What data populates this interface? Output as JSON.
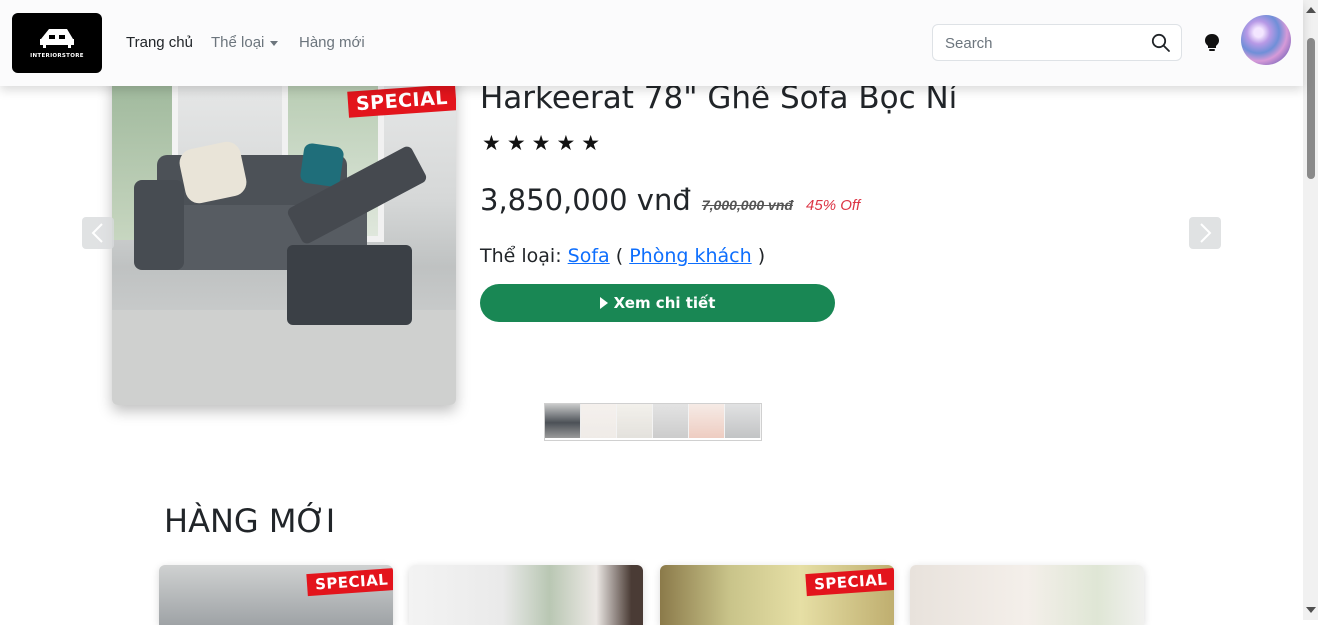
{
  "navbar": {
    "logo_text": "INTERIORSTORE",
    "links": [
      {
        "label": "Trang chủ",
        "active": true
      },
      {
        "label": "Thể loại",
        "dropdown": true
      },
      {
        "label": "Hàng mới"
      }
    ],
    "search": {
      "placeholder": "Search",
      "value": ""
    },
    "icons": {
      "search": "search-icon",
      "theme": "lightbulb-icon",
      "avatar": "avatar"
    }
  },
  "carousel": {
    "badge": "SPECIAL",
    "title": "Harkeerat 78\" Ghế Sofa Bọc Ní",
    "stars": "★★★★★",
    "rating": 5,
    "price": "3,850,000 vnđ",
    "old_price": "7,000,000 vnđ",
    "discount": "45% Off",
    "category_label": "Thể loại:",
    "category": "Sofa",
    "room_open": "(",
    "room": "Phòng khách",
    "room_close": ")",
    "detail_button": "Xem chi tiết",
    "thumbnails": 6,
    "active_thumbnail": 0
  },
  "section": {
    "title": "HÀNG MỚI",
    "cards": [
      {
        "badge": "SPECIAL"
      },
      {
        "badge": ""
      },
      {
        "badge": "SPECIAL"
      },
      {
        "badge": ""
      }
    ]
  },
  "colors": {
    "accent_green": "#198754",
    "link_blue": "#0d6efd",
    "discount_red": "#dc3545",
    "special_red": "#e3141c"
  }
}
